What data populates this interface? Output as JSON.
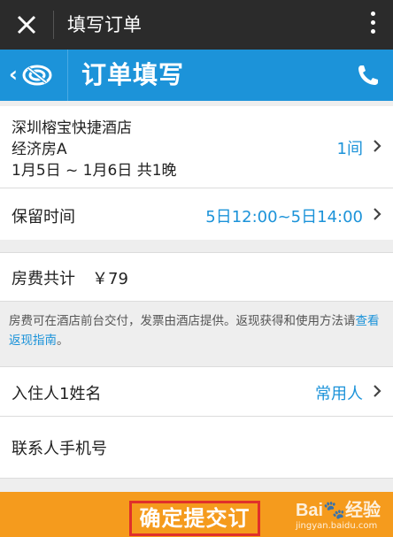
{
  "wechat_bar": {
    "title": "填写订单",
    "close_icon": "close-icon",
    "more_icon": "more-vertical-icon"
  },
  "app_bar": {
    "title": "订单填写",
    "back_icon": "back-logo-icon",
    "phone_icon": "phone-icon",
    "color": "#1c93d9"
  },
  "hotel": {
    "name": "深圳榕宝快捷酒店",
    "room_type": "经济房A",
    "dates": "1月5日 ~ 1月6日 共1晚",
    "room_count": "1间"
  },
  "hold_time": {
    "label": "保留时间",
    "value": "5日12:00~5日14:00"
  },
  "fee": {
    "label": "房费共计",
    "amount": "￥79"
  },
  "notice": {
    "text": "房费可在酒店前台交付，发票由酒店提供。返现获得和使用方法请",
    "link": "查看返现指南",
    "tail": "。"
  },
  "guest": {
    "label": "入住人1姓名",
    "value": "常用人"
  },
  "contact": {
    "label": "联系人手机号"
  },
  "submit": {
    "label": "确定提交订单",
    "color": "#f59b1d",
    "highlight_color": "#e0302a"
  },
  "watermark": {
    "logo": "Bai🐾经验",
    "url": "jingyan.baidu.com"
  }
}
